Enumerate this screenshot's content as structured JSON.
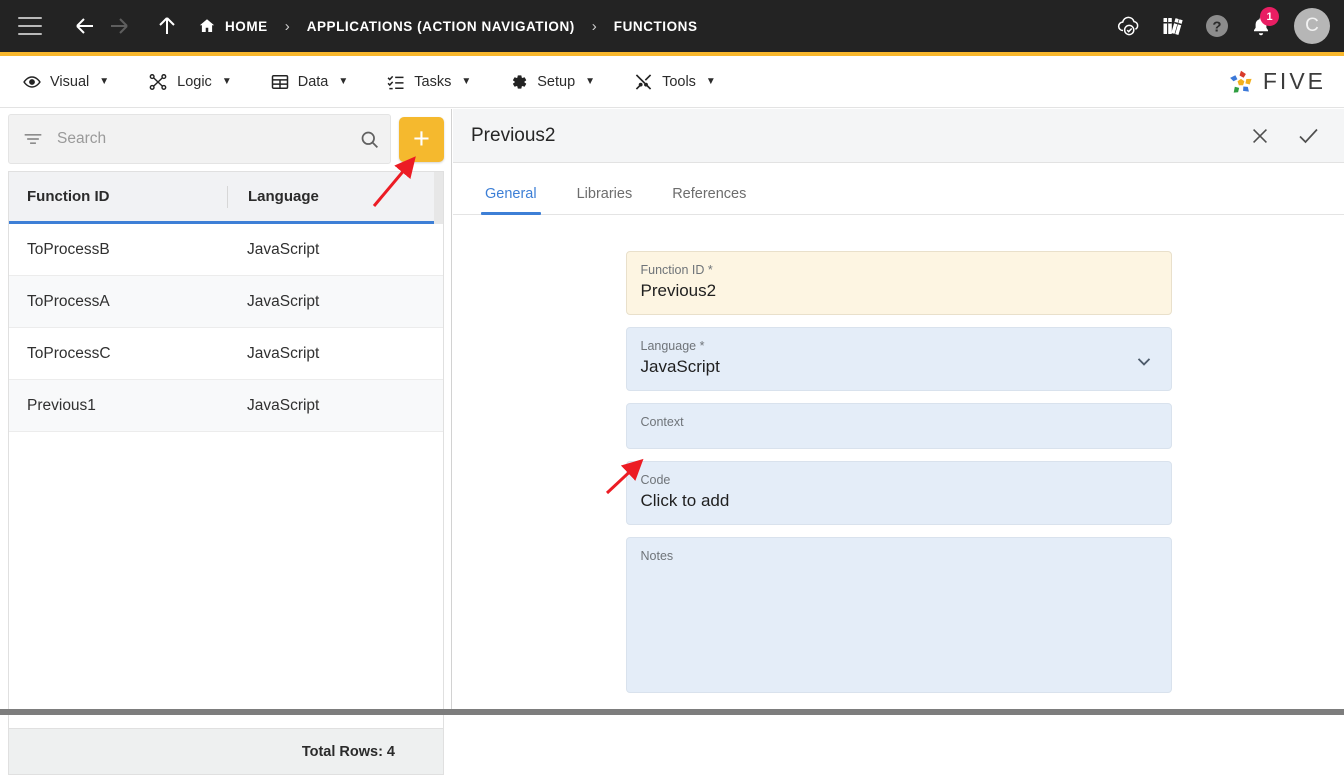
{
  "topbar": {
    "menu_icon": "hamburger-icon",
    "back_icon": "arrow-left-icon",
    "forward_icon": "arrow-right-icon",
    "up_icon": "arrow-up-icon",
    "breadcrumb": [
      {
        "label": "HOME",
        "icon": "home-icon"
      },
      {
        "label": "APPLICATIONS (ACTION NAVIGATION)"
      },
      {
        "label": "FUNCTIONS"
      }
    ],
    "separator": "›",
    "icons": [
      {
        "name": "cloud-check-icon"
      },
      {
        "name": "books-icon"
      },
      {
        "name": "help-icon"
      },
      {
        "name": "bell-icon",
        "badge": "1"
      }
    ],
    "avatar_initial": "C",
    "bg_color": "#232323",
    "accent_color": "#f8b72c",
    "badge_color": "#e91e63"
  },
  "menubar": {
    "items": [
      {
        "label": "Visual",
        "icon": "eye-icon",
        "caret": "▼"
      },
      {
        "label": "Logic",
        "icon": "logic-nodes-icon",
        "caret": "▼"
      },
      {
        "label": "Data",
        "icon": "table-grid-icon",
        "caret": "▼"
      },
      {
        "label": "Tasks",
        "icon": "checklist-icon",
        "caret": "▼"
      },
      {
        "label": "Setup",
        "icon": "gear-icon",
        "caret": "▼"
      },
      {
        "label": "Tools",
        "icon": "tools-icon",
        "caret": "▼"
      }
    ],
    "logo_text": "FIVE"
  },
  "left_panel": {
    "search": {
      "placeholder": "Search",
      "value": "",
      "filter_icon": "filter-icon",
      "search_icon": "search-icon"
    },
    "add_button_label": "+",
    "add_button_color": "#f5b92e",
    "table": {
      "columns": [
        "Function ID",
        "Language"
      ],
      "header_underline_color": "#3d7fd6",
      "rows": [
        {
          "function_id": "ToProcessB",
          "language": "JavaScript"
        },
        {
          "function_id": "ToProcessA",
          "language": "JavaScript"
        },
        {
          "function_id": "ToProcessC",
          "language": "JavaScript"
        },
        {
          "function_id": "Previous1",
          "language": "JavaScript"
        }
      ],
      "footer": "Total Rows: 4"
    }
  },
  "right_panel": {
    "title": "Previous2",
    "close_icon": "close-icon",
    "confirm_icon": "check-icon",
    "tabs": [
      {
        "label": "General",
        "active": true
      },
      {
        "label": "Libraries",
        "active": false
      },
      {
        "label": "References",
        "active": false
      }
    ],
    "active_tab_color": "#3d7fd6",
    "fields": {
      "function_id": {
        "label": "Function ID *",
        "value": "Previous2",
        "bg_color": "#fdf5e2"
      },
      "language": {
        "label": "Language *",
        "value": "JavaScript",
        "caret_icon": "chevron-down-icon",
        "bg_color": "#e4edf8"
      },
      "context": {
        "label": "Context",
        "value": "",
        "bg_color": "#e4edf8"
      },
      "code": {
        "label": "Code",
        "value": "Click to add",
        "bg_color": "#e4edf8"
      },
      "notes": {
        "label": "Notes",
        "value": "",
        "bg_color": "#e4edf8"
      }
    }
  },
  "annotations": {
    "color": "#ec1c24",
    "arrows": [
      {
        "name": "arrow-to-add-button",
        "target": "add-record-button"
      },
      {
        "name": "arrow-to-code-field",
        "target": "code-field"
      }
    ]
  }
}
